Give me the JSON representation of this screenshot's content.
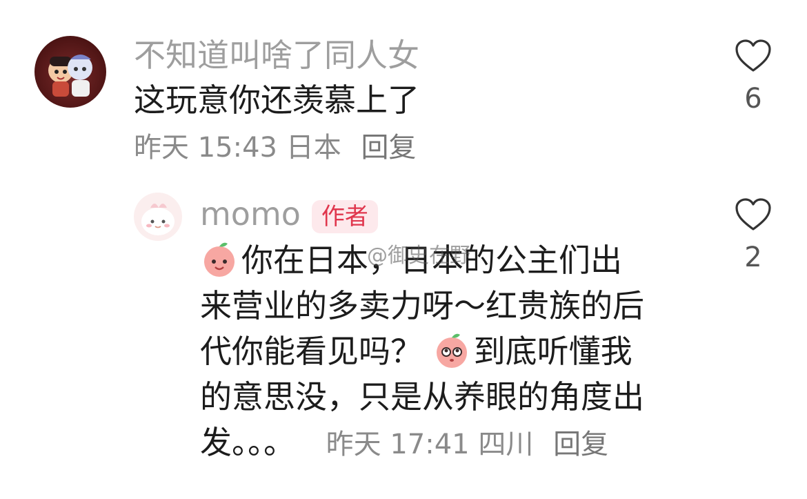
{
  "comments": [
    {
      "user": "不知道叫啥了同人女",
      "text": "这玩意你还羡慕上了",
      "time": "昨天 15:43",
      "location": "日本",
      "reply": "回复",
      "likes": "6"
    }
  ],
  "reply_comment": {
    "user": "momo",
    "badge": "作者",
    "text_line1": "你在日本，日本的公主们出",
    "text_line2": "来营业的多卖力呀～红贵族的后",
    "text_line3": "代你能看见吗？",
    "text_line3b": "到底听懂我",
    "text_line4": "的意思没，只是从养眼的角度出",
    "text_line5": "发。。。",
    "time": "昨天 17:41",
    "location": "四川",
    "reply": "回复",
    "likes": "2"
  },
  "watermark": "@御史在野",
  "icons": {
    "like": "heart-outline-icon",
    "emoji": "peach-emoji-icon"
  },
  "colors": {
    "badge_text": "#e0364d",
    "badge_bg": "#fde9ec"
  }
}
